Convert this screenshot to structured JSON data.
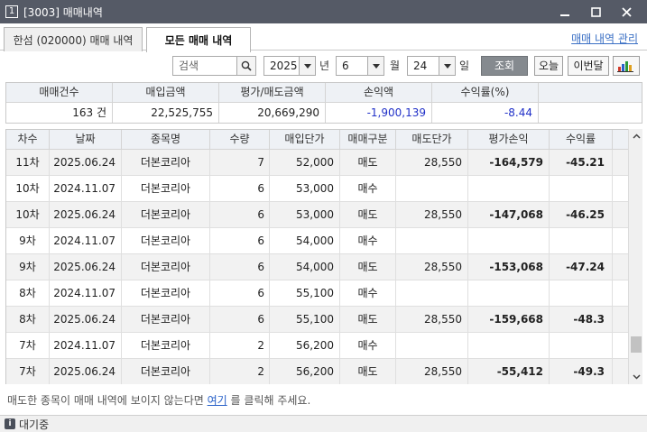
{
  "window": {
    "number": "1",
    "title": "[3003] 매매내역"
  },
  "tabs": [
    {
      "label": "한섬 (020000) 매매 내역"
    },
    {
      "label": "모든 매매 내역"
    }
  ],
  "manage_link": "매매 내역 관리",
  "search": {
    "placeholder": "검색",
    "year": "2025",
    "year_suffix": "년",
    "month": "6",
    "month_suffix": "월",
    "day": "24",
    "day_suffix": "일",
    "query_label": "조회",
    "today_label": "오늘",
    "this_month_label": "이번달"
  },
  "summary": {
    "headers": [
      "매매건수",
      "매입금액",
      "평가/매도금액",
      "손익액",
      "수익률(%)"
    ],
    "values": [
      "163 건",
      "22,525,755",
      "20,669,290",
      "-1,900,139",
      "-8.44"
    ]
  },
  "grid": {
    "headers": [
      "차수",
      "날짜",
      "종목명",
      "수량",
      "매입단가",
      "매매구분",
      "매도단가",
      "평가손익",
      "수익률"
    ],
    "rows": [
      {
        "seq": "11차",
        "date": "2025.06.24",
        "name": "더본코리아",
        "qty": "7",
        "buy_price": "52,000",
        "type": "매도",
        "sell_price": "28,550",
        "pnl": "-164,579",
        "ret": "-45.21"
      },
      {
        "seq": "10차",
        "date": "2024.11.07",
        "name": "더본코리아",
        "qty": "6",
        "buy_price": "53,000",
        "type": "매수",
        "sell_price": "",
        "pnl": "",
        "ret": ""
      },
      {
        "seq": "10차",
        "date": "2025.06.24",
        "name": "더본코리아",
        "qty": "6",
        "buy_price": "53,000",
        "type": "매도",
        "sell_price": "28,550",
        "pnl": "-147,068",
        "ret": "-46.25"
      },
      {
        "seq": "9차",
        "date": "2024.11.07",
        "name": "더본코리아",
        "qty": "6",
        "buy_price": "54,000",
        "type": "매수",
        "sell_price": "",
        "pnl": "",
        "ret": ""
      },
      {
        "seq": "9차",
        "date": "2025.06.24",
        "name": "더본코리아",
        "qty": "6",
        "buy_price": "54,000",
        "type": "매도",
        "sell_price": "28,550",
        "pnl": "-153,068",
        "ret": "-47.24"
      },
      {
        "seq": "8차",
        "date": "2024.11.07",
        "name": "더본코리아",
        "qty": "6",
        "buy_price": "55,100",
        "type": "매수",
        "sell_price": "",
        "pnl": "",
        "ret": ""
      },
      {
        "seq": "8차",
        "date": "2025.06.24",
        "name": "더본코리아",
        "qty": "6",
        "buy_price": "55,100",
        "type": "매도",
        "sell_price": "28,550",
        "pnl": "-159,668",
        "ret": "-48.3"
      },
      {
        "seq": "7차",
        "date": "2024.11.07",
        "name": "더본코리아",
        "qty": "2",
        "buy_price": "56,200",
        "type": "매수",
        "sell_price": "",
        "pnl": "",
        "ret": ""
      },
      {
        "seq": "7차",
        "date": "2025.06.24",
        "name": "더본코리아",
        "qty": "2",
        "buy_price": "56,200",
        "type": "매도",
        "sell_price": "28,550",
        "pnl": "-55,412",
        "ret": "-49.3"
      }
    ]
  },
  "info": {
    "before": "매도한 종목이 매매 내역에 보이지 않는다면",
    "link": "여기",
    "after": "를 클릭해 주세요."
  },
  "status": {
    "icon_letter": "i",
    "text": "대기중"
  },
  "colors": {
    "titlebar": "#555a66",
    "negative": "#1a2ad8",
    "link": "#2a62c9"
  }
}
